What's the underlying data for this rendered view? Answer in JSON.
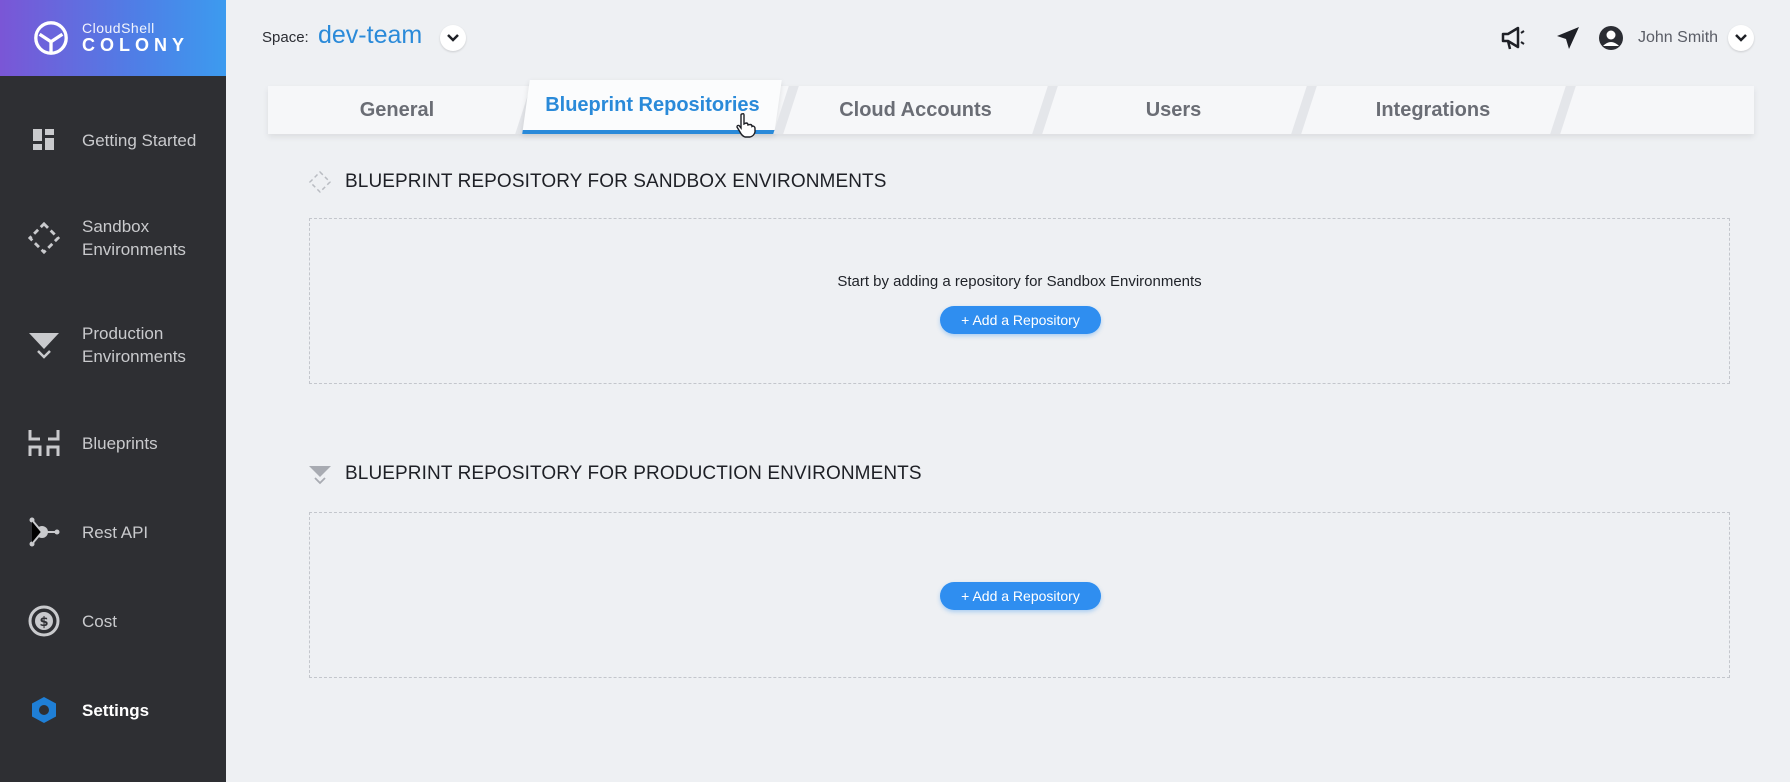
{
  "brand": {
    "top": "CloudShell",
    "bottom": "COLONY"
  },
  "sidebar": {
    "items": [
      {
        "label": "Getting Started",
        "icon": "dashboard-icon"
      },
      {
        "label": "Sandbox\nEnvironments",
        "icon": "sandbox-diamond-icon"
      },
      {
        "label": "Production\nEnvironments",
        "icon": "production-funnel-icon"
      },
      {
        "label": "Blueprints",
        "icon": "blueprint-brackets-icon"
      },
      {
        "label": "Rest API",
        "icon": "api-nodes-icon"
      },
      {
        "label": "Cost",
        "icon": "dollar-coin-icon"
      },
      {
        "label": "Settings",
        "icon": "settings-hexagon-icon",
        "active": true
      }
    ]
  },
  "header": {
    "space_label": "Space:",
    "space_value": "dev-team",
    "user_name": "John Smith",
    "icons": [
      "announcement-icon",
      "send-icon",
      "user-avatar-icon"
    ]
  },
  "tabs": [
    {
      "label": "General"
    },
    {
      "label": "Blueprint Repositories",
      "active": true
    },
    {
      "label": "Cloud Accounts"
    },
    {
      "label": "Users"
    },
    {
      "label": "Integrations"
    }
  ],
  "sections": {
    "sandbox": {
      "title": "BLUEPRINT REPOSITORY FOR SANDBOX ENVIRONMENTS",
      "hint": "Start by adding a repository for Sandbox Environments",
      "button": "+ Add a Repository"
    },
    "production": {
      "title": "BLUEPRINT REPOSITORY FOR PRODUCTION ENVIRONMENTS",
      "button": "+ Add a Repository"
    }
  },
  "colors": {
    "accent": "#2a8ad9",
    "button": "#2f8ef0",
    "sidebar": "#2e2f33",
    "settings_icon": "#1f7fd6"
  }
}
